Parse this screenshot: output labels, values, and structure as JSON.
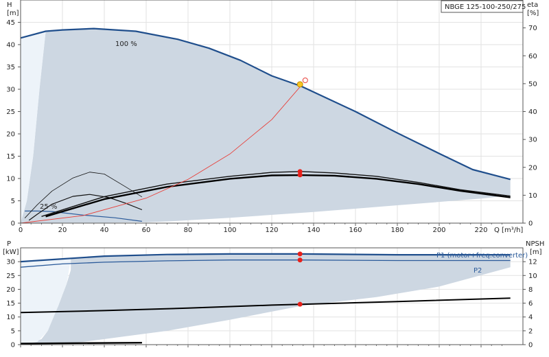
{
  "chart_data": [
    {
      "type": "line",
      "ylabel_left": "H",
      "yunit_left": "[m]",
      "ylabel_right": "eta",
      "yunit_right": "[%]",
      "xlabel": "Q [m³/h]",
      "model": "NBGE 125-100-250/275",
      "xlim": [
        0,
        240
      ],
      "ylim": [
        0,
        50
      ],
      "ylim_right": [
        0,
        80
      ],
      "x_ticks": [
        0,
        20,
        40,
        60,
        80,
        100,
        120,
        140,
        160,
        180,
        200,
        220
      ],
      "y_ticks": [
        0,
        5,
        10,
        15,
        20,
        25,
        30,
        35,
        40,
        45
      ],
      "y_ticks_right": [
        0,
        10,
        20,
        30,
        40,
        50,
        60,
        70
      ],
      "grid": true,
      "curve_labels": [
        "100 %",
        "25 %"
      ],
      "area": {
        "upper": [
          [
            0,
            41.5
          ],
          [
            12,
            43
          ],
          [
            20,
            43.3
          ],
          [
            35,
            43.6
          ],
          [
            55,
            43
          ],
          [
            75,
            41.2
          ],
          [
            90,
            39.2
          ],
          [
            105,
            36.5
          ],
          [
            120,
            33
          ],
          [
            134,
            30.7
          ],
          [
            160,
            25
          ],
          [
            180,
            20.2
          ],
          [
            200,
            15.6
          ],
          [
            216,
            12
          ],
          [
            234,
            9.8
          ]
        ],
        "lower": [
          [
            234,
            6.2
          ],
          [
            220,
            5.5
          ],
          [
            180,
            4.0
          ],
          [
            140,
            2.5
          ],
          [
            100,
            1.2
          ],
          [
            75,
            0.5
          ],
          [
            60,
            0.2
          ],
          [
            40,
            0.1
          ],
          [
            20,
            0.1
          ],
          [
            10,
            0
          ]
        ],
        "left": [
          [
            0,
            0
          ],
          [
            3,
            5
          ],
          [
            6,
            15
          ],
          [
            9,
            30
          ],
          [
            12,
            43
          ]
        ]
      },
      "series": [
        {
          "name": "100 %",
          "values": [
            [
              0,
              41.5
            ],
            [
              12,
              43
            ],
            [
              20,
              43.3
            ],
            [
              35,
              43.6
            ],
            [
              55,
              43
            ],
            [
              75,
              41.2
            ],
            [
              90,
              39.2
            ],
            [
              105,
              36.5
            ],
            [
              120,
              33
            ],
            [
              134,
              30.7
            ],
            [
              160,
              25
            ],
            [
              180,
              20.2
            ],
            [
              200,
              15.6
            ],
            [
              216,
              12
            ],
            [
              234,
              9.8
            ]
          ]
        },
        {
          "name": "25 %",
          "values": [
            [
              2,
              2.7
            ],
            [
              8,
              2.7
            ],
            [
              15,
              2.6
            ],
            [
              30,
              1.8
            ],
            [
              45,
              1.2
            ],
            [
              58,
              0.4
            ]
          ]
        },
        {
          "values": [
            [
              4,
              1
            ],
            [
              8,
              3.2
            ],
            [
              15,
              6.8
            ],
            [
              25,
              9.6
            ],
            [
              33,
              10.3
            ],
            [
              42,
              9.2
            ],
            [
              50,
              7.2
            ],
            [
              58,
              4.8
            ]
          ]
        },
        {
          "values": [
            [
              2,
              1.8
            ],
            [
              8,
              6.6
            ],
            [
              15,
              11.5
            ],
            [
              25,
              16.2
            ],
            [
              33,
              18.3
            ],
            [
              40,
              17.6
            ],
            [
              50,
              13.1
            ],
            [
              58,
              9.4
            ]
          ]
        },
        {
          "values": [
            [
              10,
              2.4
            ],
            [
              40,
              9.5
            ],
            [
              70,
              14
            ],
            [
              100,
              16.8
            ],
            [
              120,
              18.2
            ],
            [
              134,
              18.5
            ],
            [
              150,
              18.0
            ],
            [
              170,
              16.8
            ],
            [
              190,
              14.6
            ],
            [
              210,
              12
            ],
            [
              234,
              9.7
            ]
          ]
        },
        {
          "values": [
            [
              12,
              2.4
            ],
            [
              40,
              8.6
            ],
            [
              70,
              13
            ],
            [
              100,
              15.9
            ],
            [
              120,
              17.1
            ],
            [
              134,
              17.2
            ],
            [
              150,
              17.0
            ],
            [
              170,
              15.9
            ],
            [
              190,
              14.0
            ],
            [
              210,
              11.6
            ],
            [
              234,
              9.2
            ]
          ]
        },
        {
          "values": [
            [
              0,
              0
            ],
            [
              30,
              1.7
            ],
            [
              60,
              5.6
            ],
            [
              80,
              9.8
            ],
            [
              100,
              15.5
            ],
            [
              120,
              23.2
            ],
            [
              134,
              30.8
            ]
          ]
        }
      ],
      "points": [
        [
          133.5,
          31.1
        ],
        [
          136,
          32
        ],
        [
          133.5,
          18.5
        ],
        [
          133.5,
          17.3
        ]
      ]
    },
    {
      "type": "line",
      "ylabel_left": "P",
      "yunit_left": "[kW]",
      "ylabel_right": "NPSH",
      "yunit_right": "[m]",
      "xlim": [
        0,
        240
      ],
      "ylim": [
        0,
        35
      ],
      "ylim_right": [
        0,
        14
      ],
      "y_ticks": [
        0,
        5,
        10,
        15,
        20,
        25,
        30
      ],
      "y_ticks_right": [
        0,
        2,
        4,
        6,
        8,
        10,
        12
      ],
      "grid": true,
      "area": {
        "upper": [
          [
            0,
            30.0
          ],
          [
            20,
            31.0
          ],
          [
            40,
            32.0
          ],
          [
            70,
            32.6
          ],
          [
            100,
            32.8
          ],
          [
            134,
            32.8
          ],
          [
            180,
            32.5
          ],
          [
            234,
            32.5
          ]
        ],
        "lower": [
          [
            234,
            28
          ],
          [
            200,
            21
          ],
          [
            170,
            17.2
          ],
          [
            134,
            14
          ],
          [
            100,
            9
          ],
          [
            70,
            5
          ],
          [
            50,
            3
          ],
          [
            30,
            1
          ],
          [
            10,
            0
          ]
        ],
        "left": [
          [
            0,
            0
          ],
          [
            5,
            0.5
          ],
          [
            10,
            2
          ],
          [
            13,
            5
          ],
          [
            15,
            9
          ],
          [
            18,
            14
          ],
          [
            20,
            18
          ],
          [
            22,
            22
          ],
          [
            24,
            27
          ],
          [
            24,
            31
          ]
        ]
      },
      "series": [
        {
          "name": "P1 (motor+freq.converter)",
          "values": [
            [
              0,
              30.0
            ],
            [
              20,
              31.0
            ],
            [
              40,
              32.0
            ],
            [
              70,
              32.6
            ],
            [
              100,
              32.8
            ],
            [
              134,
              32.8
            ],
            [
              180,
              32.5
            ],
            [
              234,
              32.5
            ]
          ]
        },
        {
          "name": "P2",
          "values": [
            [
              0,
              28.0
            ],
            [
              20,
              29.2
            ],
            [
              40,
              29.8
            ],
            [
              70,
              30.3
            ],
            [
              100,
              30.6
            ],
            [
              134,
              30.6
            ],
            [
              180,
              30.4
            ],
            [
              234,
              30.4
            ]
          ]
        },
        {
          "values": [
            [
              0,
              11.6
            ],
            [
              40,
              12.3
            ],
            [
              80,
              13.2
            ],
            [
              120,
              14.3
            ],
            [
              134,
              14.6
            ],
            [
              180,
              15.6
            ],
            [
              234,
              16.8
            ]
          ]
        },
        {
          "values": [
            [
              0,
              0.4
            ],
            [
              58,
              0.7
            ]
          ]
        }
      ],
      "points": [
        [
          133.5,
          32.8
        ],
        [
          133.5,
          30.6
        ],
        [
          133.5,
          14.6
        ]
      ]
    }
  ]
}
